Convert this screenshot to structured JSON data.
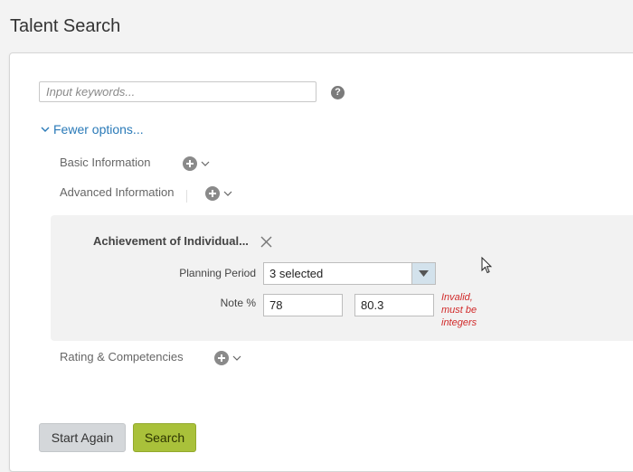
{
  "page": {
    "title": "Talent Search"
  },
  "search": {
    "placeholder": "Input keywords...",
    "value": ""
  },
  "options": {
    "toggle_label": "Fewer options...",
    "sections": [
      {
        "label": "Basic Information"
      },
      {
        "label": "Advanced Information"
      },
      {
        "label": "Rating & Competencies"
      }
    ]
  },
  "criterion": {
    "title": "Achievement of Individual...",
    "planning_period": {
      "label": "Planning Period",
      "value": "3 selected"
    },
    "note": {
      "label": "Note %",
      "from": "78",
      "to": "80.3",
      "error_lines": [
        "Invalid,",
        "must be",
        "integers"
      ]
    }
  },
  "buttons": {
    "start_again": "Start Again",
    "search": "Search"
  },
  "colors": {
    "link": "#2a7ab8",
    "primary_button": "#a9c13a",
    "secondary_button": "#d4d7da",
    "error": "#d12b2b",
    "dropdown_arrow_bg": "#d3e2ec"
  },
  "icons": [
    "help-icon",
    "chevron-down-icon",
    "plus-circle-icon",
    "close-icon",
    "dropdown-arrow-icon",
    "mouse-cursor-icon"
  ]
}
